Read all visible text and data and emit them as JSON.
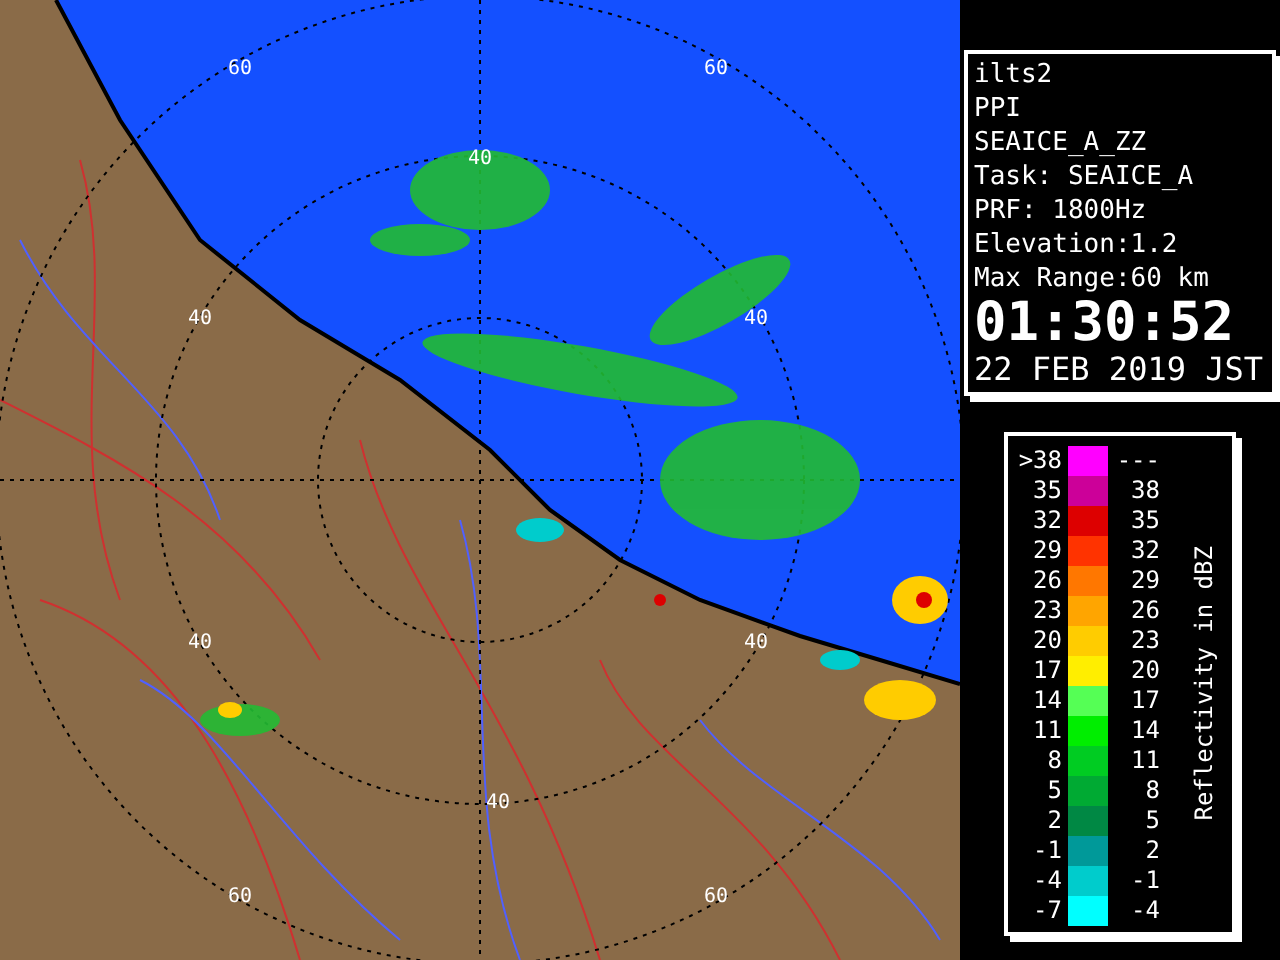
{
  "map": {
    "range_labels": [
      "60",
      "60",
      "40",
      "40",
      "40",
      "40",
      "40",
      "40",
      "60",
      "60"
    ]
  },
  "info": {
    "lines": [
      "ilts2",
      "PPI",
      "SEAICE_A_ZZ",
      "Task: SEAICE_A",
      "PRF: 1800Hz",
      "Elevation:1.2",
      "Max Range:60 km"
    ],
    "time": "01:30:52",
    "date": "22 FEB 2019 JST"
  },
  "legend": {
    "title": "Reflectivity in dBZ",
    "rows": [
      {
        "low": ">38",
        "high": "---",
        "color": "#ff00ff"
      },
      {
        "low": "35",
        "high": "38",
        "color": "#cc0099"
      },
      {
        "low": "32",
        "high": "35",
        "color": "#dd0000"
      },
      {
        "low": "29",
        "high": "32",
        "color": "#ff3300"
      },
      {
        "low": "26",
        "high": "29",
        "color": "#ff7700"
      },
      {
        "low": "23",
        "high": "26",
        "color": "#ffa500"
      },
      {
        "low": "20",
        "high": "23",
        "color": "#ffcc00"
      },
      {
        "low": "17",
        "high": "20",
        "color": "#ffee00"
      },
      {
        "low": "14",
        "high": "17",
        "color": "#55ff55"
      },
      {
        "low": "11",
        "high": "14",
        "color": "#00ee00"
      },
      {
        "low": "8",
        "high": "11",
        "color": "#00cc22"
      },
      {
        "low": "5",
        "high": "8",
        "color": "#00aa33"
      },
      {
        "low": "2",
        "high": "5",
        "color": "#008844"
      },
      {
        "low": "-1",
        "high": "2",
        "color": "#009999"
      },
      {
        "low": "-4",
        "high": "-1",
        "color": "#00cccc"
      },
      {
        "low": "-7",
        "high": "-4",
        "color": "#00ffff"
      }
    ]
  }
}
